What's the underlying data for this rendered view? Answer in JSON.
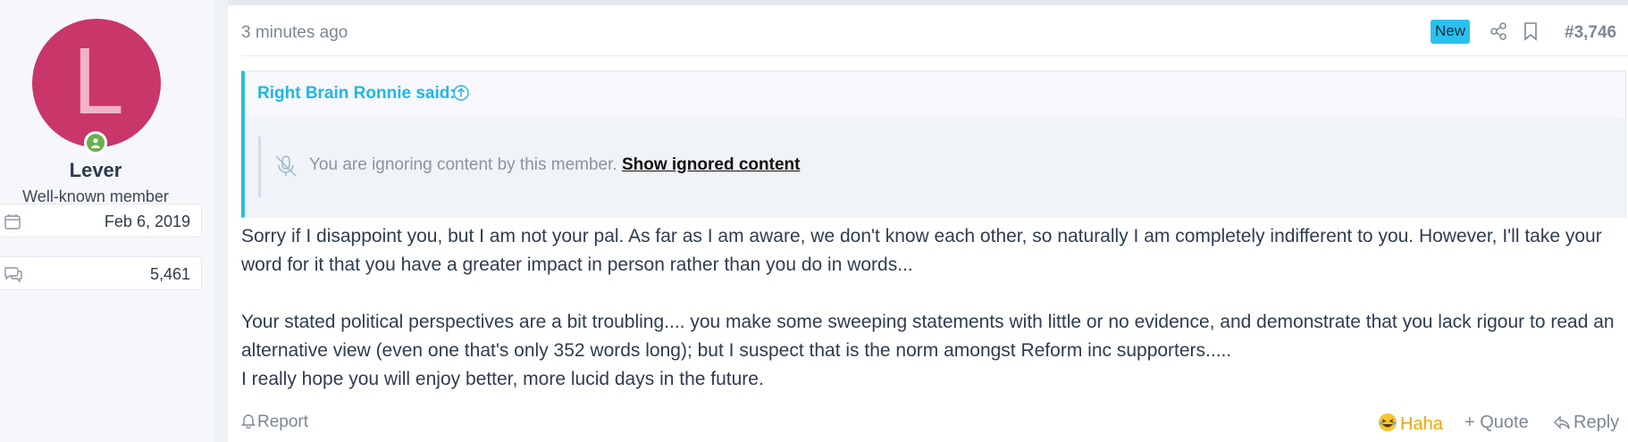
{
  "user": {
    "avatar_letter": "L",
    "avatar_color": "#c9366a",
    "name": "Lever",
    "title": "Well-known member",
    "joined": "Feb 6, 2019",
    "messages": "5,461"
  },
  "post": {
    "time": "3 minutes ago",
    "badge": "New",
    "number": "#3,746",
    "quote": {
      "author": "Right Brain Ronnie said:",
      "ignored_text": "You are ignoring content by this member.",
      "show_link": "Show ignored content"
    },
    "body": {
      "p1": "Sorry if I disappoint you, but I am not your pal. As far as I am aware, we don't know each other, so naturally I am completely indifferent to you. However, I'll take your word for it that you have a greater impact in person rather than you do in words...",
      "p2": "Your stated political perspectives are a bit troubling.... you make some sweeping statements with little or no evidence, and demonstrate that you lack rigour to read an alternative view (even one that's only 352 words long); but I suspect that is the norm amongst Reform inc supporters.....",
      "p3": "I really hope you will enjoy better, more lucid days in the future."
    }
  },
  "actions": {
    "report": "Report",
    "reaction": "Haha",
    "quote": "+ Quote",
    "reply": "Reply"
  },
  "colors": {
    "accent": "#2bbbe8",
    "badge": "#2bc0f0",
    "reaction": "#f0a500",
    "online": "#6ab04c"
  },
  "icons": [
    "online-status-icon",
    "calendar-icon",
    "messages-icon",
    "share-icon",
    "bookmark-icon",
    "arrow-up-circle-icon",
    "muted-mic-icon",
    "bell-icon",
    "laugh-emoji-icon",
    "reply-arrow-icon"
  ]
}
